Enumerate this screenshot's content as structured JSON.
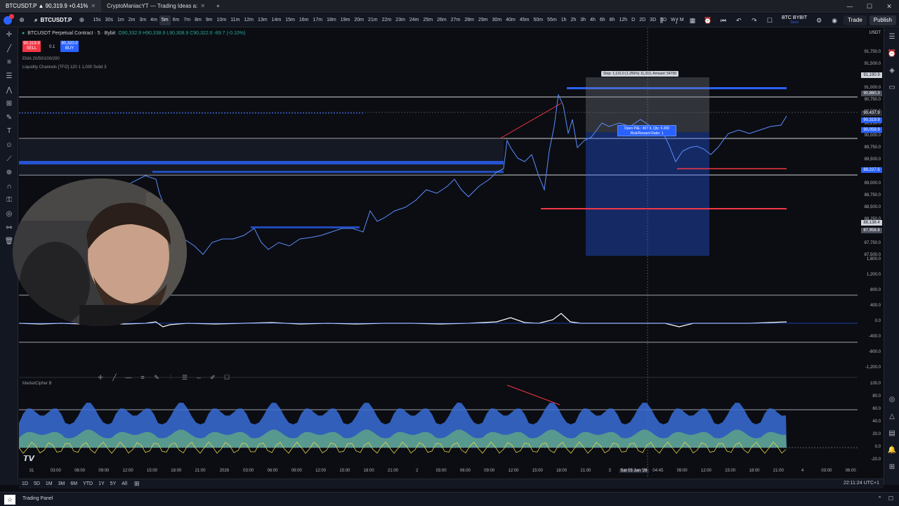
{
  "browser": {
    "tabs": [
      {
        "title": "BTCUSDT.P ▲ 90,319.9 +0.41%",
        "active": true
      },
      {
        "title": "CryptoManiacYT — Trading Ideas a:",
        "active": false
      }
    ],
    "new_tab": "+",
    "window_controls": [
      "—",
      "☐",
      "✕"
    ]
  },
  "toolbar": {
    "symbol": "BTCUSDT.P",
    "timeframes": [
      "15s",
      "30s",
      "1m",
      "2m",
      "3m",
      "4m",
      "5m",
      "6m",
      "7m",
      "8m",
      "9m",
      "10m",
      "11m",
      "12m",
      "13m",
      "14m",
      "15m",
      "16m",
      "17m",
      "18m",
      "19m",
      "20m",
      "21m",
      "22m",
      "23m",
      "24m",
      "25m",
      "26m",
      "27m",
      "28m",
      "29m",
      "30m",
      "40m",
      "45m",
      "50m",
      "55m",
      "1h",
      "2h",
      "3h",
      "4h",
      "6h",
      "8h",
      "12h",
      "D",
      "2D",
      "3D",
      "5D",
      "W",
      "M"
    ],
    "active_timeframe": "5m",
    "broker": "BTC BYBIT",
    "broker_sub": "Save",
    "trade_label": "Trade",
    "publish_label": "Publish"
  },
  "legend": {
    "title": "BTCUSDT Perpetual Contract · 5 · Bybit",
    "ohlc": "O90,332.9 H90,338.9 L90,308.9 C90,322.6 -89.7 (-0.10%)",
    "sell_price": "90,319.9",
    "sell_label": "SELL",
    "spread": "0.1",
    "buy_price": "90,320.0",
    "buy_label": "BUY",
    "ema_label": "EMA 20/50/100/200",
    "liquidity_label": "Liquidity Channels [TFO] 120 1 1,000 Solid 3",
    "market_cipher_label": "MarketCipher B"
  },
  "position": {
    "stop_label": "Stop: 1,131.0 (1.256%) 11,310, Amount: 54700",
    "box_line1": "Open P&L: 407.9, Qty: 0.200",
    "box_line2": "Risk/Reward Ratio: 1"
  },
  "price_axis": {
    "labels": [
      "91,750.0",
      "91,500.0",
      "91,250.0",
      "91,000.0",
      "90,750.0",
      "90,500.0",
      "90,250.0",
      "90,000.0",
      "89,750.0",
      "89,500.0",
      "89,250.0",
      "89,000.0",
      "88,750.0",
      "88,500.0",
      "88,250.0",
      "88,000.0",
      "87,750.0",
      "87,500.0",
      "1,600.0",
      "1,200.0",
      "800.0",
      "400.0",
      "0.0",
      "-400.0",
      "-800.0",
      "-1,200.0",
      "100.0",
      "80.0",
      "60.0",
      "40.0",
      "20.0",
      "0.0",
      "-20.0"
    ],
    "tags": [
      {
        "text": "91,190.9",
        "color": "#d1d4dc"
      },
      {
        "text": "90,860.3",
        "color": "#4a4f5c"
      },
      {
        "text": "90,437.9",
        "color": "#2a2e39"
      },
      {
        "text": "90,319.9",
        "color": "#2962ff"
      },
      {
        "text": "90,059.9",
        "color": "#2962ff"
      },
      {
        "text": "89,227.5",
        "color": "#2962ff"
      },
      {
        "text": "88,138.4",
        "color": "#d1d4dc"
      },
      {
        "text": "87,958.8",
        "color": "#4a4f5c"
      }
    ],
    "currency": "USDT"
  },
  "time_axis": {
    "labels": [
      "31",
      "03:00",
      "06:00",
      "09:00",
      "12:00",
      "15:00",
      "18:00",
      "21:00",
      "2026",
      "03:00",
      "06:00",
      "09:00",
      "12:00",
      "15:00",
      "18:00",
      "21:00",
      "2",
      "03:00",
      "06:00",
      "09:00",
      "12:00",
      "15:00",
      "18:00",
      "21:00",
      "3",
      "Sat 03 Jan '26",
      "04:45",
      "09:00",
      "12:00",
      "15:00",
      "18:00",
      "21:00",
      "4",
      "03:00",
      "06:00"
    ]
  },
  "bottom_bar": {
    "ranges": [
      "1D",
      "5D",
      "1M",
      "3M",
      "6M",
      "YTD",
      "1Y",
      "5Y",
      "All"
    ],
    "clock": "22:11:24 UTC+1"
  },
  "panel": {
    "label": "Trading Panel"
  },
  "icons": {
    "left_tools": [
      "cursor-icon",
      "trend-line-icon",
      "horizontal-line-icon",
      "fib-icon",
      "pattern-icon",
      "prediction-icon",
      "brush-icon",
      "text-icon",
      "emoji-icon",
      "ruler-icon",
      "zoom-icon",
      "magnet-icon",
      "lock-icon",
      "eye-icon",
      "link-icon",
      "trash-icon"
    ],
    "right_tools": [
      "watchlist-icon",
      "alerts-icon",
      "layers-icon",
      "chat-icon",
      "calendar-icon",
      "notification-icon",
      "help-icon"
    ]
  }
}
